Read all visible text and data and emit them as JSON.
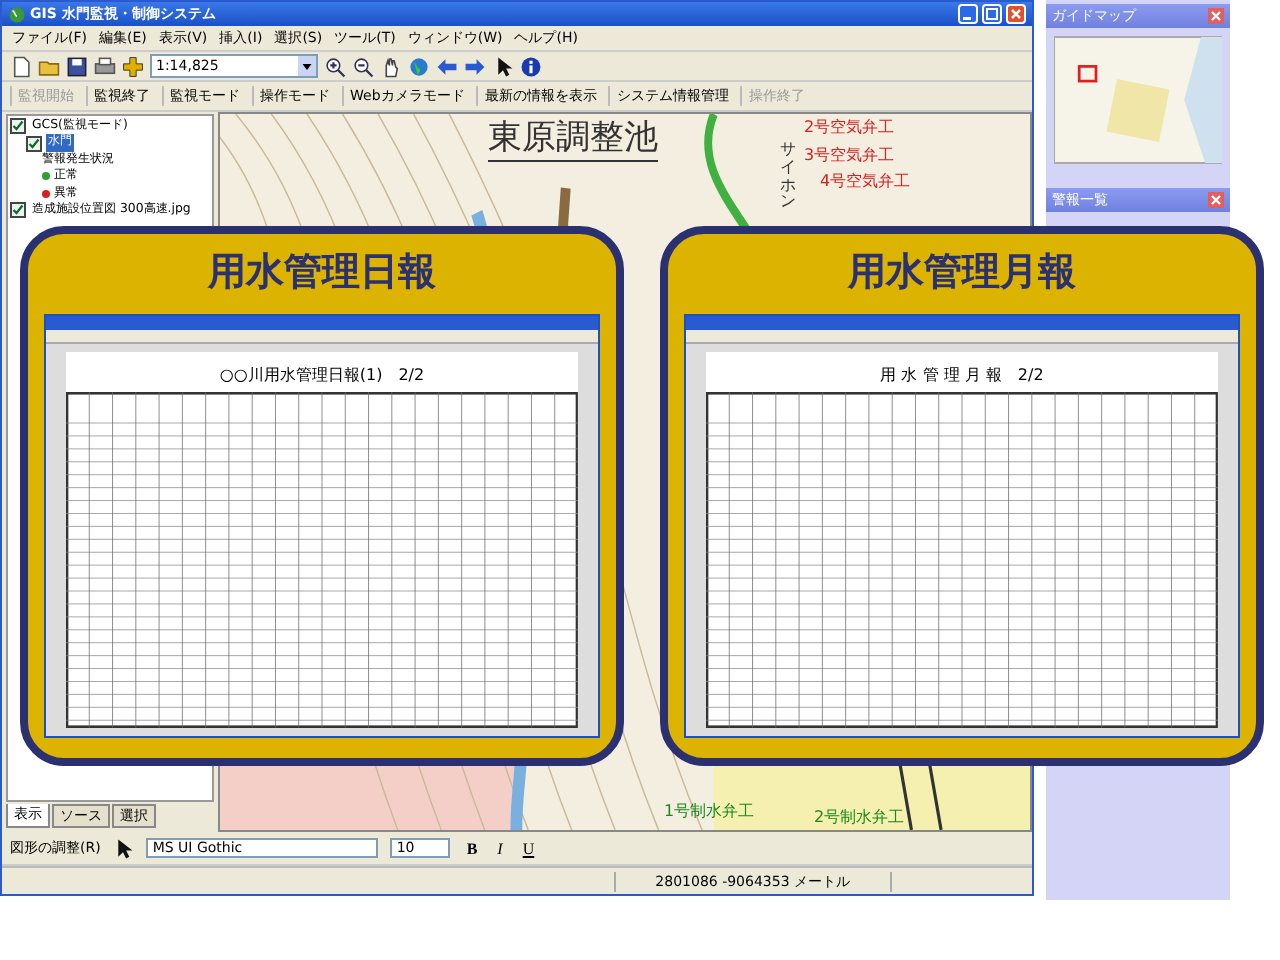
{
  "window": {
    "title": "GIS 水門監視・制御システム"
  },
  "menu": [
    "ファイル(F)",
    "編集(E)",
    "表示(V)",
    "挿入(I)",
    "選択(S)",
    "ツール(T)",
    "ウィンドウ(W)",
    "ヘルプ(H)"
  ],
  "toolbar": {
    "scale": "1:14,825"
  },
  "mode_toolbar": [
    {
      "label": "監視開始",
      "disabled": true
    },
    {
      "label": "監視終了",
      "disabled": false
    },
    {
      "label": "監視モード",
      "disabled": false
    },
    {
      "label": "操作モード",
      "disabled": false
    },
    {
      "label": "Webカメラモード",
      "disabled": false
    },
    {
      "label": "最新の情報を表示",
      "disabled": false
    },
    {
      "label": "システム情報管理",
      "disabled": false
    },
    {
      "label": "操作終了",
      "disabled": true
    }
  ],
  "layers": [
    {
      "label": "GCS(監視モード)",
      "checked": true,
      "selected": false,
      "children": [
        {
          "label": "水門",
          "checked": true,
          "selected": true,
          "legend": [
            {
              "label": "警報発生状況"
            },
            {
              "label": "正常",
              "color": "#2e9e2e"
            },
            {
              "label": "異常",
              "color": "#d42020"
            }
          ]
        }
      ]
    },
    {
      "label": "造成施設位置図 300高速.jpg",
      "checked": true,
      "selected": false
    }
  ],
  "panel_tabs": [
    {
      "label": "表示",
      "selected": true
    },
    {
      "label": "ソース",
      "selected": false
    },
    {
      "label": "選択",
      "selected": false
    }
  ],
  "map_labels": [
    {
      "text": "東原調整池",
      "kind": "title"
    },
    {
      "text": "2号空気弁工",
      "kind": "air_valve"
    },
    {
      "text": "3号空気弁工",
      "kind": "air_valve"
    },
    {
      "text": "4号空気弁工",
      "kind": "air_valve"
    },
    {
      "text": "サイホン",
      "kind": "pipe"
    },
    {
      "text": "1号制水弁工",
      "kind": "control_valve"
    },
    {
      "text": "2号制水弁工",
      "kind": "control_valve"
    }
  ],
  "side_panels": [
    {
      "title": "ガイドマップ"
    },
    {
      "title": "警報一覧"
    }
  ],
  "reports": [
    {
      "title": "用水管理日報",
      "sheet_title": "○○川用水管理日報(1)　2/2"
    },
    {
      "title": "用水管理月報",
      "sheet_title": "用 水 管 理 月 報　2/2"
    }
  ],
  "drawing_toolbar": {
    "adjust": "図形の調整(R)",
    "font": "MS UI Gothic",
    "size": "10",
    "styles": [
      "B",
      "I",
      "U"
    ]
  },
  "status_bar": {
    "coordinates": "2801086 -9064353 メートル"
  }
}
